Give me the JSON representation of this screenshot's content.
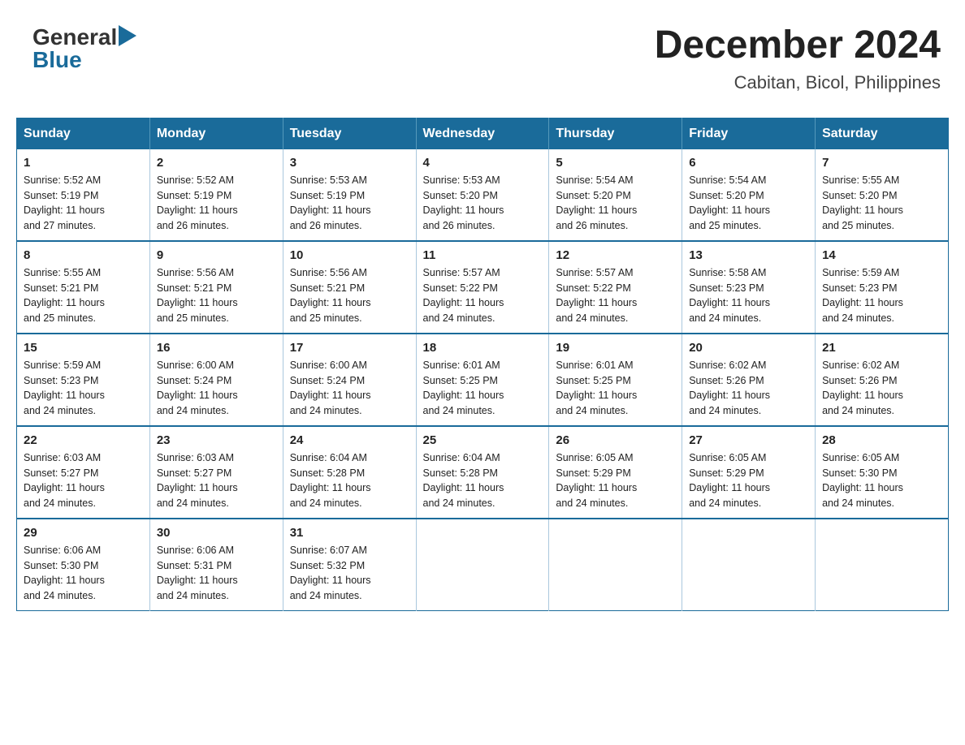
{
  "header": {
    "logo_general": "General",
    "logo_blue": "Blue",
    "title": "December 2024",
    "subtitle": "Cabitan, Bicol, Philippines"
  },
  "calendar": {
    "days_of_week": [
      "Sunday",
      "Monday",
      "Tuesday",
      "Wednesday",
      "Thursday",
      "Friday",
      "Saturday"
    ],
    "weeks": [
      [
        {
          "day": "1",
          "sunrise": "5:52 AM",
          "sunset": "5:19 PM",
          "daylight": "11 hours and 27 minutes."
        },
        {
          "day": "2",
          "sunrise": "5:52 AM",
          "sunset": "5:19 PM",
          "daylight": "11 hours and 26 minutes."
        },
        {
          "day": "3",
          "sunrise": "5:53 AM",
          "sunset": "5:19 PM",
          "daylight": "11 hours and 26 minutes."
        },
        {
          "day": "4",
          "sunrise": "5:53 AM",
          "sunset": "5:20 PM",
          "daylight": "11 hours and 26 minutes."
        },
        {
          "day": "5",
          "sunrise": "5:54 AM",
          "sunset": "5:20 PM",
          "daylight": "11 hours and 26 minutes."
        },
        {
          "day": "6",
          "sunrise": "5:54 AM",
          "sunset": "5:20 PM",
          "daylight": "11 hours and 25 minutes."
        },
        {
          "day": "7",
          "sunrise": "5:55 AM",
          "sunset": "5:20 PM",
          "daylight": "11 hours and 25 minutes."
        }
      ],
      [
        {
          "day": "8",
          "sunrise": "5:55 AM",
          "sunset": "5:21 PM",
          "daylight": "11 hours and 25 minutes."
        },
        {
          "day": "9",
          "sunrise": "5:56 AM",
          "sunset": "5:21 PM",
          "daylight": "11 hours and 25 minutes."
        },
        {
          "day": "10",
          "sunrise": "5:56 AM",
          "sunset": "5:21 PM",
          "daylight": "11 hours and 25 minutes."
        },
        {
          "day": "11",
          "sunrise": "5:57 AM",
          "sunset": "5:22 PM",
          "daylight": "11 hours and 24 minutes."
        },
        {
          "day": "12",
          "sunrise": "5:57 AM",
          "sunset": "5:22 PM",
          "daylight": "11 hours and 24 minutes."
        },
        {
          "day": "13",
          "sunrise": "5:58 AM",
          "sunset": "5:23 PM",
          "daylight": "11 hours and 24 minutes."
        },
        {
          "day": "14",
          "sunrise": "5:59 AM",
          "sunset": "5:23 PM",
          "daylight": "11 hours and 24 minutes."
        }
      ],
      [
        {
          "day": "15",
          "sunrise": "5:59 AM",
          "sunset": "5:23 PM",
          "daylight": "11 hours and 24 minutes."
        },
        {
          "day": "16",
          "sunrise": "6:00 AM",
          "sunset": "5:24 PM",
          "daylight": "11 hours and 24 minutes."
        },
        {
          "day": "17",
          "sunrise": "6:00 AM",
          "sunset": "5:24 PM",
          "daylight": "11 hours and 24 minutes."
        },
        {
          "day": "18",
          "sunrise": "6:01 AM",
          "sunset": "5:25 PM",
          "daylight": "11 hours and 24 minutes."
        },
        {
          "day": "19",
          "sunrise": "6:01 AM",
          "sunset": "5:25 PM",
          "daylight": "11 hours and 24 minutes."
        },
        {
          "day": "20",
          "sunrise": "6:02 AM",
          "sunset": "5:26 PM",
          "daylight": "11 hours and 24 minutes."
        },
        {
          "day": "21",
          "sunrise": "6:02 AM",
          "sunset": "5:26 PM",
          "daylight": "11 hours and 24 minutes."
        }
      ],
      [
        {
          "day": "22",
          "sunrise": "6:03 AM",
          "sunset": "5:27 PM",
          "daylight": "11 hours and 24 minutes."
        },
        {
          "day": "23",
          "sunrise": "6:03 AM",
          "sunset": "5:27 PM",
          "daylight": "11 hours and 24 minutes."
        },
        {
          "day": "24",
          "sunrise": "6:04 AM",
          "sunset": "5:28 PM",
          "daylight": "11 hours and 24 minutes."
        },
        {
          "day": "25",
          "sunrise": "6:04 AM",
          "sunset": "5:28 PM",
          "daylight": "11 hours and 24 minutes."
        },
        {
          "day": "26",
          "sunrise": "6:05 AM",
          "sunset": "5:29 PM",
          "daylight": "11 hours and 24 minutes."
        },
        {
          "day": "27",
          "sunrise": "6:05 AM",
          "sunset": "5:29 PM",
          "daylight": "11 hours and 24 minutes."
        },
        {
          "day": "28",
          "sunrise": "6:05 AM",
          "sunset": "5:30 PM",
          "daylight": "11 hours and 24 minutes."
        }
      ],
      [
        {
          "day": "29",
          "sunrise": "6:06 AM",
          "sunset": "5:30 PM",
          "daylight": "11 hours and 24 minutes."
        },
        {
          "day": "30",
          "sunrise": "6:06 AM",
          "sunset": "5:31 PM",
          "daylight": "11 hours and 24 minutes."
        },
        {
          "day": "31",
          "sunrise": "6:07 AM",
          "sunset": "5:32 PM",
          "daylight": "11 hours and 24 minutes."
        },
        null,
        null,
        null,
        null
      ]
    ],
    "labels": {
      "sunrise": "Sunrise:",
      "sunset": "Sunset:",
      "daylight": "Daylight:"
    }
  }
}
